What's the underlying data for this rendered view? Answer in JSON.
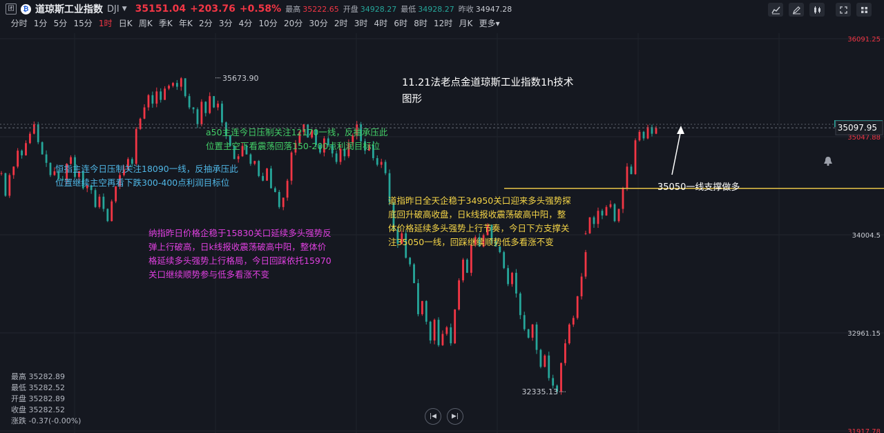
{
  "header": {
    "badge": "团",
    "logo": "₿",
    "name": "道琼斯工业指数",
    "code": "DJI",
    "price": "35151.04",
    "change": "+203.76",
    "change_pct": "+0.58%",
    "high_label": "最高",
    "high_value": "35222.65",
    "open_label": "开盘",
    "open_value": "34928.27",
    "low_label": "最低",
    "low_value": "34928.27",
    "prev_label": "昨收",
    "prev_value": "34947.28"
  },
  "timeframes": [
    "分时",
    "1分",
    "5分",
    "15分",
    "1时",
    "日K",
    "周K",
    "季K",
    "年K",
    "2分",
    "3分",
    "4分",
    "10分",
    "20分",
    "30分",
    "2时",
    "3时",
    "4时",
    "6时",
    "8时",
    "12时",
    "月K",
    "更多"
  ],
  "active_timeframe": "1时",
  "colors": {
    "up": "#f23645",
    "down": "#26a69a",
    "bg": "#151820",
    "support": "#e8c547"
  },
  "chart_data": {
    "type": "candlestick",
    "title": "11.21法老点金道琼斯工业指数1h技术图形",
    "y_ticks": [
      "36091.25",
      "35047.88",
      "34004.5",
      "32961.15",
      "31917.78"
    ],
    "y_range": [
      31917.78,
      36091.25
    ],
    "price_tag": "35151.04",
    "crosshair_value": "35097.95",
    "high_marker": "35673.90",
    "low_marker": "32335.13",
    "support_level": 35050,
    "support_label": "35050一线支撑做多",
    "trend_path": [
      [
        34660,
        34420,
        34640,
        34730,
        34900,
        34850,
        34980,
        35080,
        35180,
        34990,
        34860,
        34770,
        34640,
        34680,
        34600,
        34590,
        34760,
        34830
      ],
      [
        34620,
        34680,
        34500,
        34530,
        34480,
        34300,
        34410,
        34280,
        34150,
        34360,
        34520,
        34640,
        34700,
        34810,
        34760,
        35130,
        35240,
        35360
      ],
      [
        35490,
        35400,
        35530,
        35440,
        35560,
        35590,
        35620,
        35580,
        35670,
        35480,
        35360,
        35340,
        35180,
        35420,
        35300,
        35480,
        35360,
        35400
      ],
      [
        35200,
        35060,
        34950,
        34810,
        34840,
        34950,
        34860,
        34760,
        34790,
        34630,
        34580,
        34710,
        34500,
        34460,
        34300,
        34400,
        34580,
        34880
      ],
      [
        34980,
        35100,
        35180,
        35040,
        35120,
        34960,
        34880,
        35030,
        34960,
        34870,
        34780,
        34920,
        34840,
        34980,
        35060,
        35180,
        35000,
        34900
      ],
      [
        34960,
        34820,
        34750,
        34780,
        34660,
        34350,
        34060,
        33910,
        34020,
        33760,
        33690,
        33490,
        33160,
        33300,
        33080,
        32880,
        33100,
        32830
      ],
      [
        32950,
        33020,
        32850,
        33210,
        33520,
        33740,
        33600,
        33900,
        33980,
        33880,
        34000,
        34110,
        33940,
        33880,
        33820,
        33650,
        33480,
        33600
      ],
      [
        33380,
        33150,
        33000,
        32910,
        33050,
        32780,
        32600,
        32720,
        32480,
        32400,
        32335,
        32640,
        32850,
        33050,
        33120,
        33350,
        33560,
        33820
      ],
      [
        34020,
        34190,
        34120,
        34260,
        34210,
        34300,
        34330,
        34150,
        34280,
        34500,
        34730,
        34650,
        35010,
        35100,
        35030,
        35150,
        35080,
        35140
      ]
    ],
    "annotations": [
      {
        "id": "hsi",
        "text": "恒指主连今日压制关注18090一线，反抽承压此位置继续主空再看下跌300-400点利润目标位",
        "color": "#4fb6e5"
      },
      {
        "id": "a50",
        "text": "a50主连今日压制关注12170一线，反抽承压此位置主空下看震荡回落150-200点利润目标位",
        "color": "#44d068"
      },
      {
        "id": "nasdaq",
        "text": "纳指昨日价格企稳于15830关口延续多头强势反弹上行破高，日k线报收震荡破高中阳，整体价格延续多头强势上行格局，今日回踩依托15970关口继续顺势参与低多看涨不变",
        "color": "#e040e0"
      },
      {
        "id": "dow",
        "text": "道指昨日全天企稳于34950关口迎来多头强势探底回升破高收盘，日k线报收震荡破高中阳，整体价格延续多头强势上行节奏，今日下方支撑关注35050一线，回踩继续顺势低多看涨不变",
        "color": "#f5d547"
      }
    ]
  },
  "info": {
    "high_label": "最高",
    "high_value": "35282.89",
    "low_label": "最低",
    "low_value": "35282.52",
    "open_label": "开盘",
    "open_value": "35282.89",
    "close_label": "收盘",
    "close_value": "35282.52",
    "change_label": "涨跌",
    "change_value": "-0.37(-0.00%)"
  },
  "title_lines": [
    "11.21法老点金道琼斯工业指数1h技术",
    "图形"
  ],
  "hsi_lines": [
    "恒指主连今日压制关注18090一线，反抽承压此",
    "位置继续主空再看下跌300-400点利润目标位"
  ],
  "a50_lines": [
    "a50主连今日压制关注12170一线，反抽承压此",
    "位置主空下看震荡回落150-200点利润目标位"
  ],
  "nasdaq_lines": [
    "纳指昨日价格企稳于15830关口延续多头强势反",
    "弹上行破高，日k线报收震荡破高中阳，整体价",
    "格延续多头强势上行格局，今日回踩依托15970",
    "关口继续顺势参与低多看涨不变"
  ],
  "dow_lines": [
    "道指昨日全天企稳于34950关口迎来多头强势探",
    "底回升破高收盘，日k线报收震荡破高中阳，整",
    "体价格延续多头强势上行节奏，今日下方支撑关",
    "注35050一线，回踩继续顺势低多看涨不变"
  ]
}
